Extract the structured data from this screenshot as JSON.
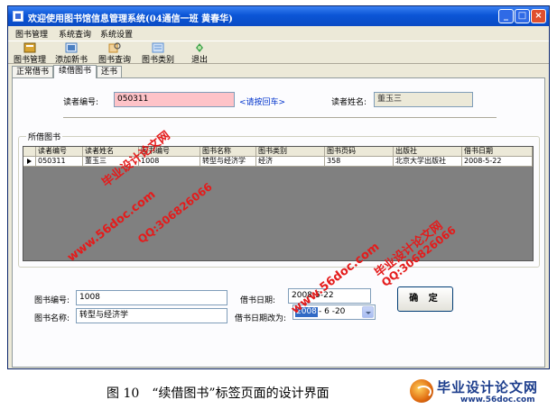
{
  "window": {
    "title": "欢迎使用图书馆信息管理系统(04通信一班  黄春华)",
    "controls": {
      "minimize": "_",
      "maximize": "□",
      "close": "×"
    }
  },
  "menu": [
    "图书管理",
    "系统查询",
    "系统设置"
  ],
  "toolbar": [
    {
      "label": "图书管理",
      "icon": "book-manage-icon",
      "color": "#d9a431"
    },
    {
      "label": "添加新书",
      "icon": "add-book-icon",
      "color": "#4a7fc1"
    },
    {
      "label": "图书查询",
      "icon": "book-search-icon",
      "color": "#c58a2a"
    },
    {
      "label": "图书类别",
      "icon": "book-category-icon",
      "color": "#5b8fd3"
    },
    {
      "label": "退出",
      "icon": "exit-icon",
      "color": "#3fa24b"
    }
  ],
  "tabs": [
    {
      "label": "正常借书",
      "active": false
    },
    {
      "label": "续借图书",
      "active": true
    },
    {
      "label": "还书",
      "active": false
    }
  ],
  "reader": {
    "id_label": "读者编号:",
    "id_value": "050311",
    "hint": "<请按回车>",
    "name_label": "读者姓名:",
    "name_value": "董玉三"
  },
  "borrowed": {
    "group_title": "所借图书",
    "columns": [
      "读者编号",
      "读者姓名",
      "图书编号",
      "图书名称",
      "图书类别",
      "图书页码",
      "出版社",
      "借书日期"
    ],
    "rows": [
      [
        "050311",
        "董玉三",
        "1008",
        "转型与经济学",
        "经济",
        "358",
        "北京大学出版社",
        "2008-5-22"
      ]
    ]
  },
  "form": {
    "book_id_label": "图书编号:",
    "book_id_value": "1008",
    "book_name_label": "图书名称:",
    "book_name_value": "转型与经济学",
    "borrow_date_label": "借书日期:",
    "borrow_date_value": "2008-5-22",
    "new_date_label": "借书日期改为:",
    "new_date_year": "2008",
    "new_date_rest": "- 6 -20",
    "confirm_label": "确 定"
  },
  "watermarks": [
    "毕业设计论文网",
    "www.56doc.com",
    "QQ:306826066"
  ],
  "caption": "图 10　“续借图书”标签页面的设计界面",
  "logo": {
    "text": "毕业设计论文网",
    "url": "www.56doc.com"
  },
  "colors": {
    "titlebar": "#0b55d6",
    "pink_field": "#fec3c8",
    "watermark_red": "#e41b1b",
    "selection": "#316ac5"
  }
}
